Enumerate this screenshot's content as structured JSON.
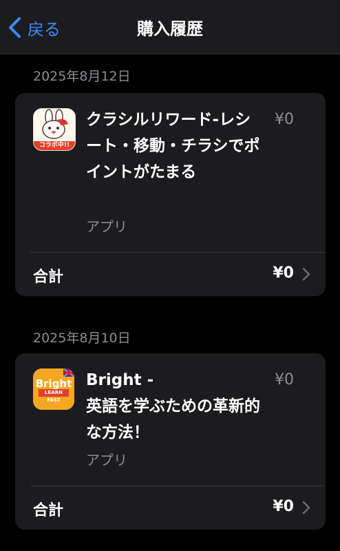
{
  "nav": {
    "back_label": "戻る",
    "title": "購入履歴"
  },
  "groups": [
    {
      "date": "2025年8月12日",
      "app_name": "クラシルリワード-レシート・移動・チラシでポイントがたまる",
      "app_kind": "アプリ",
      "price": "¥0",
      "icon_label": "コラボ中!!",
      "total_label": "合計",
      "total_value": "¥0"
    },
    {
      "date": "2025年8月10日",
      "app_name_line1": "Bright -",
      "app_name_line2": "英語を学ぶための革新的な方法！",
      "app_kind": "アプリ",
      "price": "¥0",
      "icon_brand": "Bright",
      "icon_tagline": "LEARN FAST",
      "total_label": "合計",
      "total_value": "¥0"
    }
  ],
  "colors": {
    "accent": "#3b8cf7",
    "card_bg": "#1c1c1e",
    "secondary_text": "#8e8e93",
    "bright_icon_orange": "#f5a623"
  }
}
